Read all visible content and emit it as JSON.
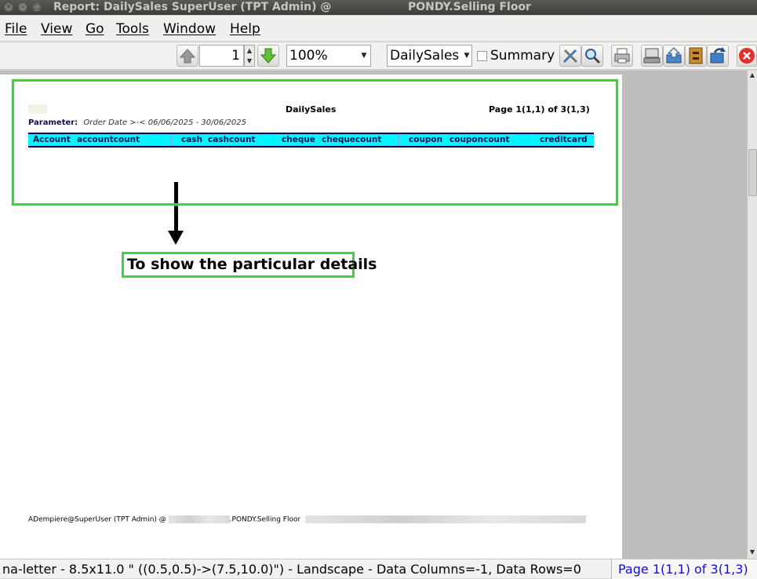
{
  "window": {
    "title": "Report: DailySales  SuperUser (TPT Admin) @",
    "title_right": "PONDY.Selling Floor"
  },
  "menu": {
    "items": [
      {
        "label": "File"
      },
      {
        "label": "View"
      },
      {
        "label": "Go"
      },
      {
        "label": "Tools"
      },
      {
        "label": "Window"
      },
      {
        "label": "Help"
      }
    ]
  },
  "toolbar": {
    "page_number": "1",
    "zoom": "100%",
    "report": "DailySales",
    "summary_label": "Summary",
    "summary_checked": false
  },
  "report": {
    "title": "DailySales",
    "page_info": "Page 1(1,1) of 3(1,3)",
    "parameter_label": "Parameter:",
    "parameter_value": "Order Date   >-<   06/06/2025 - 30/06/2025",
    "columns": [
      "Account",
      "accountcount",
      "cash",
      "cashcount",
      "cheque",
      "chequecount",
      "coupon",
      "couponcount",
      "creditcard"
    ],
    "footer_left": "ADempiere@SuperUser (TPT Admin) @",
    "footer_org": ".PONDY.Selling Floor",
    "header_color": "#00f7ff"
  },
  "annotation": {
    "text": "To show the particular details",
    "highlight_color": "#3fd43f"
  },
  "status": {
    "left": "na-letter - 8.5x11.0 \" ((0.5,0.5)->(7.5,10.0)\") - Landscape - Data Columns=-1, Data Rows=0",
    "right": "Page 1(1,1) of 3(1,3)"
  }
}
